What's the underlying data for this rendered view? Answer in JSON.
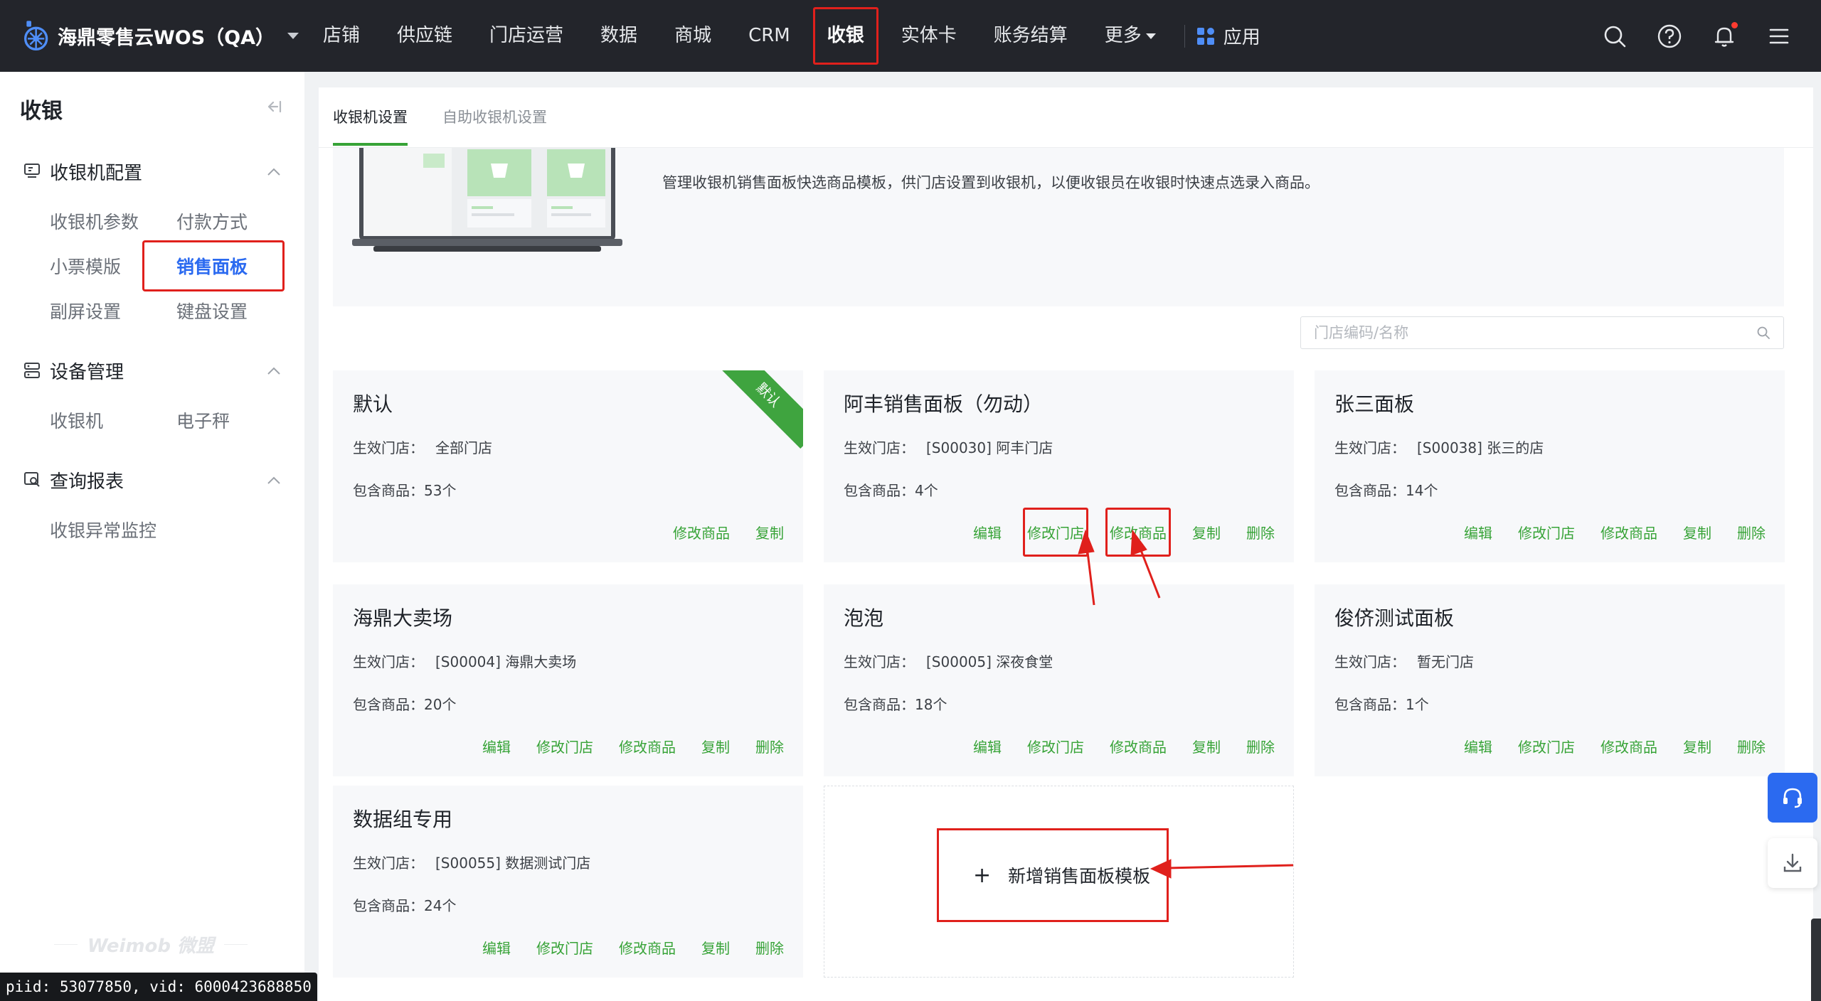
{
  "app": {
    "name": "海鼎零售云WOS（QA）"
  },
  "nav": {
    "items": [
      "店铺",
      "供应链",
      "门店运营",
      "数据",
      "商城",
      "CRM",
      "收银",
      "实体卡",
      "账务结算"
    ],
    "more": "更多",
    "apps": "应用"
  },
  "sidebar": {
    "title": "收银",
    "groups": [
      {
        "label": "收银机配置",
        "links": [
          "收银机参数",
          "付款方式",
          "小票模版",
          "销售面板",
          "副屏设置",
          "键盘设置"
        ]
      },
      {
        "label": "设备管理",
        "links": [
          "收银机",
          "电子秤"
        ]
      },
      {
        "label": "查询报表",
        "links": [
          "收银异常监控"
        ]
      }
    ],
    "watermark": "Weimob 微盟"
  },
  "tabs": [
    "收银机设置",
    "自助收银机设置"
  ],
  "banner": {
    "description": "管理收银机销售面板快选商品模板，供门店设置到收银机，以便收银员在收银时快速点选录入商品。"
  },
  "search": {
    "placeholder": "门店编码/名称"
  },
  "labels": {
    "stores": "生效门店：",
    "products": "包含商品："
  },
  "cards": [
    {
      "title": "默认",
      "stores": "全部门店",
      "products": "53个",
      "badge": "默认",
      "actions": [
        "修改商品",
        "复制"
      ]
    },
    {
      "title": "阿丰销售面板（勿动）",
      "stores": "[S00030] 阿丰门店",
      "products": "4个",
      "actions": [
        "编辑",
        "修改门店",
        "修改商品",
        "复制",
        "删除"
      ]
    },
    {
      "title": "张三面板",
      "stores": "[S00038] 张三的店",
      "products": "14个",
      "actions": [
        "编辑",
        "修改门店",
        "修改商品",
        "复制",
        "删除"
      ]
    },
    {
      "title": "海鼎大卖场",
      "stores": "[S00004] 海鼎大卖场",
      "products": "20个",
      "actions": [
        "编辑",
        "修改门店",
        "修改商品",
        "复制",
        "删除"
      ]
    },
    {
      "title": "泡泡",
      "stores": "[S00005] 深夜食堂",
      "products": "18个",
      "actions": [
        "编辑",
        "修改门店",
        "修改商品",
        "复制",
        "删除"
      ]
    },
    {
      "title": "俊侪测试面板",
      "stores": "暂无门店",
      "products": "1个",
      "actions": [
        "编辑",
        "修改门店",
        "修改商品",
        "复制",
        "删除"
      ]
    },
    {
      "title": "数据组专用",
      "stores": "[S00055] 数据测试门店",
      "products": "24个",
      "actions": [
        "编辑",
        "修改门店",
        "修改商品",
        "复制",
        "删除"
      ]
    }
  ],
  "add_template": {
    "plus": "+",
    "label": "新增销售面板模板"
  },
  "footer": {
    "id_text": "piid: 53077850, vid: 6000423688850"
  },
  "colors": {
    "topbar": "#23252b",
    "accent_green": "#37a337",
    "highlight_red": "#e0201c",
    "link_blue": "#2b6af0"
  }
}
